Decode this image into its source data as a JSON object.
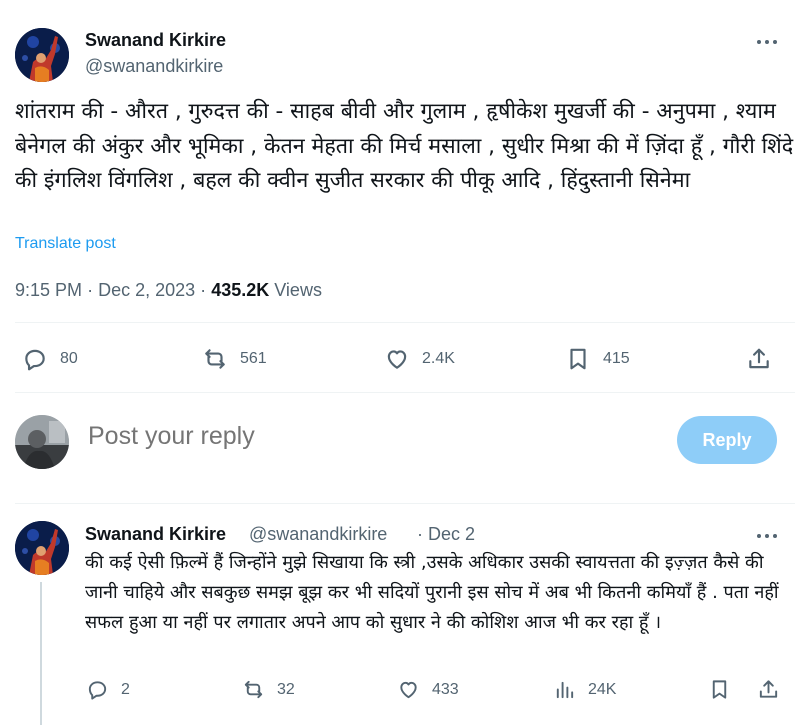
{
  "tweet": {
    "author_name": "Swanand Kirkire",
    "author_handle": "@swanandkirkire",
    "text": "शांतराम की - औरत , गुरुदत्त की - साहब बीवी और गुलाम , हृषीकेश मुखर्जी की - अनुपमा , श्याम बेनेगल की अंकुर और भूमिका , केतन मेहता की मिर्च मसाला , सुधीर मिश्रा की में ज़िंदा हूँ , गौरी शिंदे की इंगलिश विंगलिश , बहल की क्वीन सुजीत सरकार की पीकू आदि , हिंदुस्तानी सिनेमा",
    "translate_label": "Translate post",
    "time": "9:15 PM",
    "separator": "·",
    "date": "Dec 2, 2023",
    "views_count": "435.2K",
    "views_label": "Views",
    "stats": {
      "replies": "80",
      "reposts": "561",
      "likes": "2.4K",
      "bookmarks": "415"
    }
  },
  "reply_box": {
    "placeholder": "Post your reply",
    "button_label": "Reply"
  },
  "reply": {
    "author_name": "Swanand Kirkire",
    "author_handle": "@swanandkirkire",
    "date": "· Dec 2",
    "text": "की कई ऐसी  फ़िल्में हैं  जिन्होंने मुझे सिखाया कि स्त्री ,उसके अधिकार उसकी स्वायत्तता की इज़्ज़त कैसे की जानी चाहिये और सबकुछ समझ बूझ कर भी सदियों पुरानी इस सोच में अब भी कितनी कमियाँ हैं . पता नहीं सफल हुआ या नहीं पर लगातार अपने आप को सुधार ने की कोशिश आज भी कर रहा हूँ ।",
    "stats": {
      "replies": "2",
      "reposts": "32",
      "likes": "433",
      "views": "24K"
    }
  },
  "colors": {
    "accent": "#1d9bf0",
    "reply_button": "#8ecdf8",
    "secondary_text": "#536471",
    "primary_text": "#0f1419"
  }
}
